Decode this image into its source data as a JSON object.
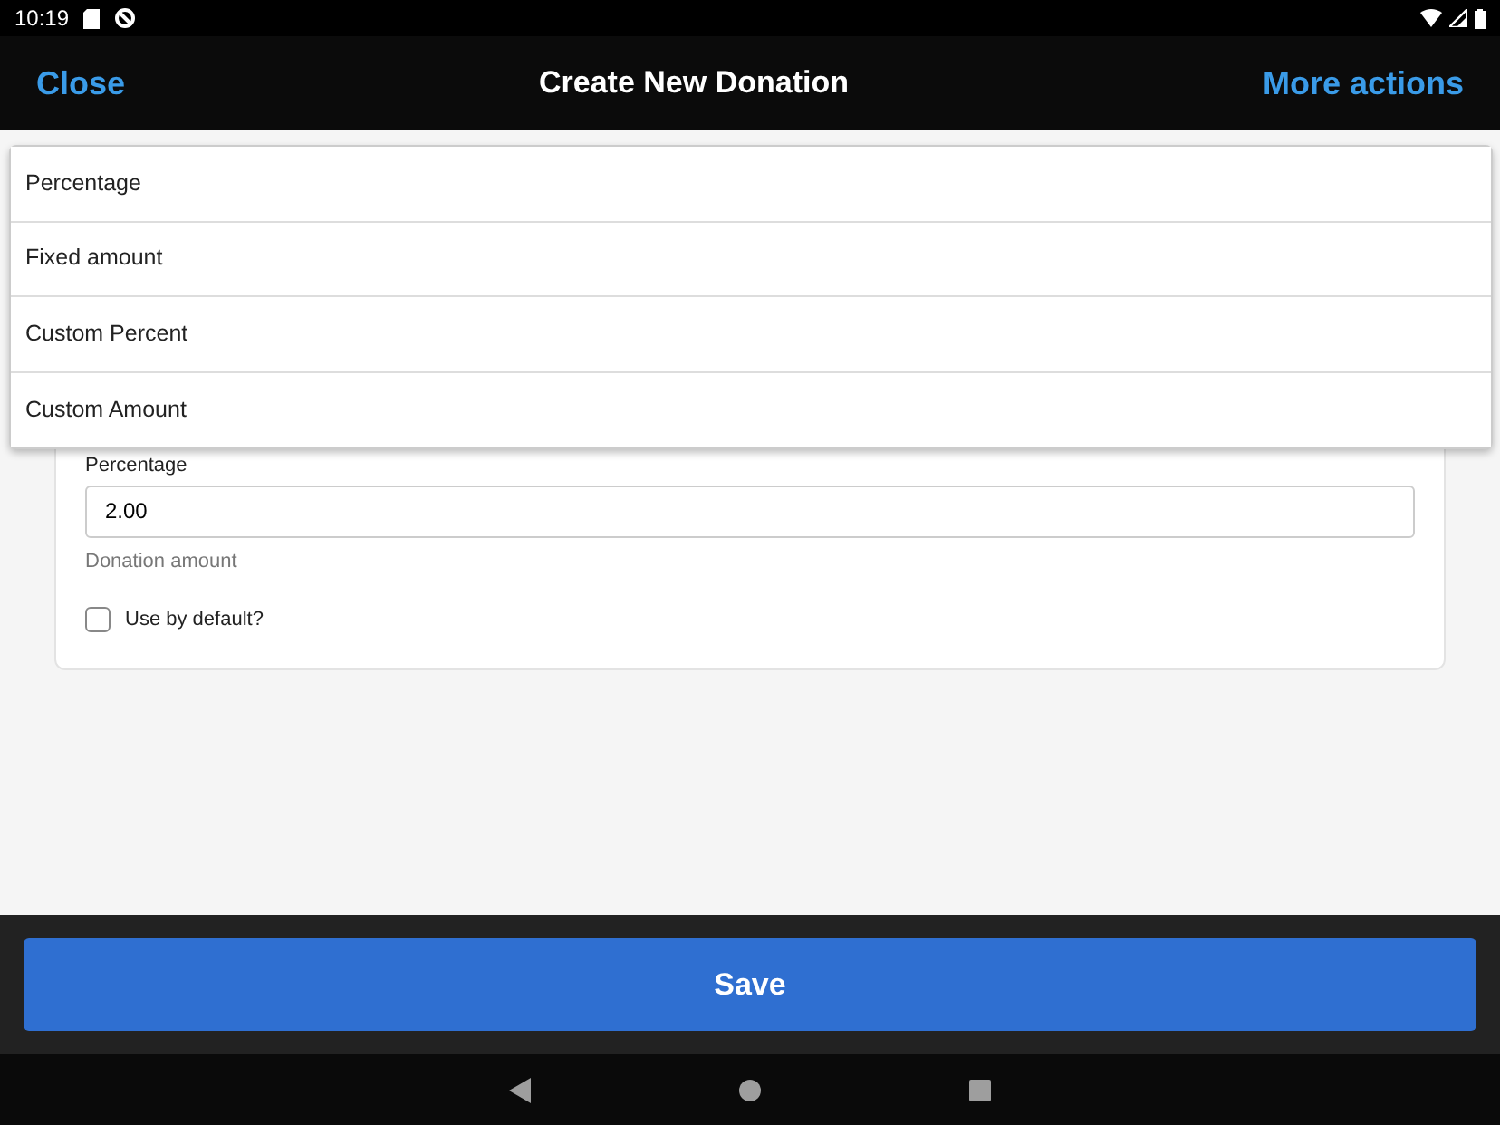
{
  "status_bar": {
    "time": "10:19"
  },
  "header": {
    "close": "Close",
    "title": "Create New Donation",
    "more": "More actions"
  },
  "form": {
    "field_label": "Percentage",
    "field_value": "2.00",
    "field_help": "Donation amount",
    "checkbox": {
      "label": "Use by default?",
      "checked": false
    }
  },
  "dropdown": {
    "options": [
      {
        "label": "Percentage"
      },
      {
        "label": "Fixed amount"
      },
      {
        "label": "Custom Percent"
      },
      {
        "label": "Custom Amount"
      }
    ]
  },
  "footer": {
    "save": "Save"
  }
}
